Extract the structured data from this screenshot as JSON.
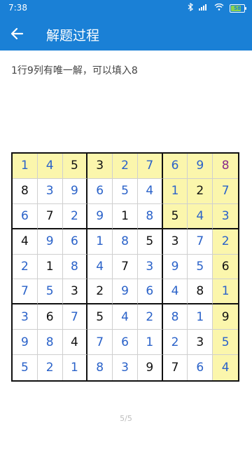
{
  "status": {
    "time": "7:38",
    "battery": "58"
  },
  "app": {
    "title": "解题过程"
  },
  "hint": "1行9列有唯一解，可以填入8",
  "pager": "5/5",
  "sudoku": {
    "values": [
      [
        1,
        4,
        5,
        3,
        2,
        7,
        6,
        9,
        8
      ],
      [
        8,
        3,
        9,
        6,
        5,
        4,
        1,
        2,
        7
      ],
      [
        6,
        7,
        2,
        9,
        1,
        8,
        5,
        4,
        3
      ],
      [
        4,
        9,
        6,
        1,
        8,
        5,
        3,
        7,
        2
      ],
      [
        2,
        1,
        8,
        4,
        7,
        3,
        9,
        5,
        6
      ],
      [
        7,
        5,
        3,
        2,
        9,
        6,
        4,
        8,
        1
      ],
      [
        3,
        6,
        7,
        5,
        4,
        2,
        8,
        1,
        9
      ],
      [
        9,
        8,
        4,
        7,
        6,
        1,
        2,
        3,
        5
      ],
      [
        5,
        2,
        1,
        8,
        3,
        9,
        7,
        6,
        4
      ]
    ],
    "kind": [
      [
        "f",
        "f",
        "g",
        "g",
        "f",
        "f",
        "f",
        "f",
        "t"
      ],
      [
        "g",
        "f",
        "f",
        "f",
        "f",
        "f",
        "f",
        "g",
        "f"
      ],
      [
        "f",
        "g",
        "f",
        "f",
        "g",
        "f",
        "g",
        "f",
        "f"
      ],
      [
        "g",
        "f",
        "f",
        "f",
        "f",
        "g",
        "g",
        "f",
        "f"
      ],
      [
        "f",
        "g",
        "f",
        "f",
        "g",
        "f",
        "f",
        "f",
        "g"
      ],
      [
        "f",
        "f",
        "g",
        "g",
        "f",
        "f",
        "f",
        "g",
        "f"
      ],
      [
        "f",
        "g",
        "f",
        "g",
        "f",
        "f",
        "f",
        "f",
        "g"
      ],
      [
        "f",
        "f",
        "g",
        "f",
        "f",
        "f",
        "f",
        "g",
        "f"
      ],
      [
        "f",
        "f",
        "f",
        "f",
        "f",
        "g",
        "g",
        "f",
        "f"
      ]
    ],
    "highlight": [
      [
        1,
        1,
        1,
        1,
        1,
        1,
        1,
        1,
        1
      ],
      [
        0,
        0,
        0,
        0,
        0,
        0,
        1,
        1,
        1
      ],
      [
        0,
        0,
        0,
        0,
        0,
        0,
        1,
        1,
        1
      ],
      [
        0,
        0,
        0,
        0,
        0,
        0,
        0,
        0,
        1
      ],
      [
        0,
        0,
        0,
        0,
        0,
        0,
        0,
        0,
        1
      ],
      [
        0,
        0,
        0,
        0,
        0,
        0,
        0,
        0,
        1
      ],
      [
        0,
        0,
        0,
        0,
        0,
        0,
        0,
        0,
        1
      ],
      [
        0,
        0,
        0,
        0,
        0,
        0,
        0,
        0,
        1
      ],
      [
        0,
        0,
        0,
        0,
        0,
        0,
        0,
        0,
        1
      ]
    ]
  },
  "colors": {
    "accent": "#1a80d6",
    "highlight": "#fbf6ac",
    "filled": "#2a62c9",
    "target": "#8a2c8a"
  },
  "icons": {
    "back": "arrow-left-icon"
  }
}
